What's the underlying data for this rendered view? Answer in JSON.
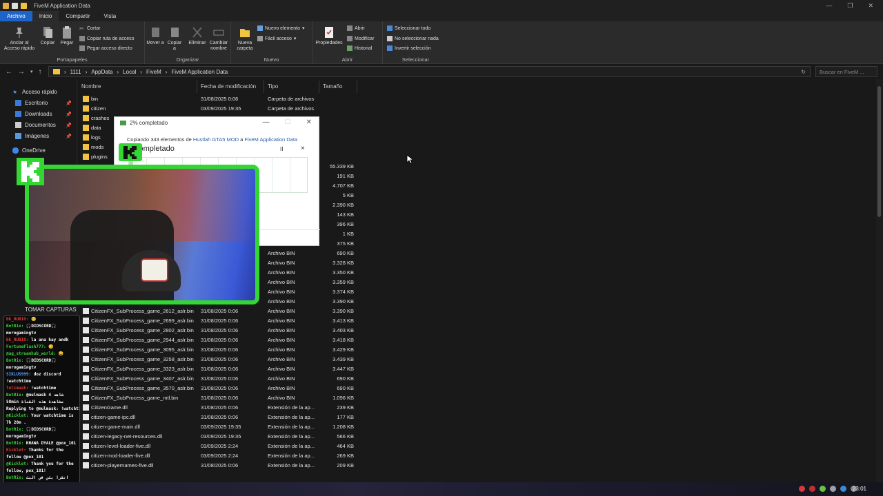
{
  "window": {
    "title": "FiveM Application Data"
  },
  "ribbon_tabs": [
    "Archivo",
    "Inicio",
    "Compartir",
    "Vista"
  ],
  "ribbon": {
    "pin_label": "Anclar al Acceso rápido",
    "copy": "Copiar",
    "paste": "Pegar",
    "cut": "Cortar",
    "copy_path": "Copiar ruta de acceso",
    "paste_shortcut": "Pegar acceso directo",
    "move_to": "Mover a",
    "copy_to": "Copiar a",
    "delete": "Eliminar",
    "rename": "Cambiar nombre",
    "new_folder": "Nueva carpeta",
    "new_item": "Nuevo elemento",
    "easy_access": "Fácil acceso",
    "properties": "Propiedades",
    "open": "Abrir",
    "edit": "Modificar",
    "history": "Historial",
    "select_all": "Seleccionar todo",
    "select_none": "No seleccionar nada",
    "invert": "Invertir selección",
    "groups": [
      "Portapapeles",
      "Organizar",
      "Nuevo",
      "Abrir",
      "Seleccionar"
    ]
  },
  "address": {
    "crumbs": [
      "1111",
      "AppData",
      "Local",
      "FiveM",
      "FiveM Application Data"
    ],
    "search_placeholder": "Buscar en FiveM ..."
  },
  "nav": {
    "quick": "Acceso rápido",
    "items": [
      "Escritorio",
      "Downloads",
      "Documentos",
      "Imágenes"
    ],
    "onedrive": "OneDrive",
    "capturas": "TOMAR CAPTURAS"
  },
  "columns": {
    "name": "Nombre",
    "date": "Fecha de modificación",
    "type": "Tipo",
    "size": "Tamaño"
  },
  "folders": [
    {
      "name": "bin",
      "date": "31/08/2025 0:06",
      "type": "Carpeta de archivos"
    },
    {
      "name": "citizen",
      "date": "03/09/2025 19:35",
      "type": "Carpeta de archivos"
    },
    {
      "name": "crashes"
    },
    {
      "name": "data"
    },
    {
      "name": "logs"
    },
    {
      "name": "mods"
    },
    {
      "name": "plugins"
    }
  ],
  "hidden_sizes": [
    "55.339 KB",
    "191 KB",
    "4.707 KB",
    "5 KB",
    "2.390 KB",
    "143 KB",
    "396 KB",
    "1 KB",
    "375 KB"
  ],
  "files": [
    {
      "name": "",
      "date": "",
      "type": "Archivo BIN",
      "size": "690 KB"
    },
    {
      "name": "",
      "date": "",
      "type": "Archivo BIN",
      "size": "3.328 KB"
    },
    {
      "name": "",
      "date": "",
      "type": "Archivo BIN",
      "size": "3.350 KB"
    },
    {
      "name": "",
      "date": "",
      "type": "Archivo BIN",
      "size": "3.359 KB"
    },
    {
      "name": "",
      "date": "",
      "type": "Archivo BIN",
      "size": "3.374 KB"
    },
    {
      "name": "",
      "date": "",
      "type": "Archivo BIN",
      "size": "3.390 KB"
    },
    {
      "name": "CitizenFX_SubProcess_game_2612_aslr.bin",
      "date": "31/08/2025 0:06",
      "type": "Archivo BIN",
      "size": "3.390 KB"
    },
    {
      "name": "CitizenFX_SubProcess_game_2699_aslr.bin",
      "date": "31/08/2025 0:06",
      "type": "Archivo BIN",
      "size": "3.413 KB"
    },
    {
      "name": "CitizenFX_SubProcess_game_2802_aslr.bin",
      "date": "31/08/2025 0:06",
      "type": "Archivo BIN",
      "size": "3.403 KB"
    },
    {
      "name": "CitizenFX_SubProcess_game_2944_aslr.bin",
      "date": "31/08/2025 0:06",
      "type": "Archivo BIN",
      "size": "3.418 KB"
    },
    {
      "name": "CitizenFX_SubProcess_game_3095_aslr.bin",
      "date": "31/08/2025 0:06",
      "type": "Archivo BIN",
      "size": "3.429 KB"
    },
    {
      "name": "CitizenFX_SubProcess_game_3258_aslr.bin",
      "date": "31/08/2025 0:06",
      "type": "Archivo BIN",
      "size": "3.439 KB"
    },
    {
      "name": "CitizenFX_SubProcess_game_3323_aslr.bin",
      "date": "31/08/2025 0:06",
      "type": "Archivo BIN",
      "size": "3.447 KB"
    },
    {
      "name": "CitizenFX_SubProcess_game_3407_aslr.bin",
      "date": "31/08/2025 0:06",
      "type": "Archivo BIN",
      "size": "690 KB"
    },
    {
      "name": "CitizenFX_SubProcess_game_3570_aslr.bin",
      "date": "31/08/2025 0:06",
      "type": "Archivo BIN",
      "size": "690 KB"
    },
    {
      "name": "CitizenFX_SubProcess_game_mtl.bin",
      "date": "31/08/2025 0:06",
      "type": "Archivo BIN",
      "size": "1.096 KB"
    },
    {
      "name": "CitizenGame.dll",
      "date": "31/08/2025 0:06",
      "type": "Extensión de la ap...",
      "size": "239 KB"
    },
    {
      "name": "citizen-game-ipc.dll",
      "date": "31/08/2025 0:06",
      "type": "Extensión de la ap...",
      "size": "177 KB"
    },
    {
      "name": "citizen-game-main.dll",
      "date": "03/09/2025 19:35",
      "type": "Extensión de la ap...",
      "size": "1.208 KB"
    },
    {
      "name": "citizen-legacy-net-resources.dll",
      "date": "03/09/2025 19:35",
      "type": "Extensión de la ap...",
      "size": "566 KB"
    },
    {
      "name": "citizen-level-loader-five.dll",
      "date": "03/09/2025 2:24",
      "type": "Extensión de la ap...",
      "size": "464 KB"
    },
    {
      "name": "citizen-mod-loader-five.dll",
      "date": "03/09/2025 2:24",
      "type": "Extensión de la ap...",
      "size": "269 KB"
    },
    {
      "name": "citizen-playernames-five.dll",
      "date": "31/08/2025 0:06",
      "type": "Extensión de la ap...",
      "size": "209 KB"
    }
  ],
  "dialog": {
    "title": "2% completado",
    "line_prefix": "Copiando 343 elementos de ",
    "src": "Hustlah GTA5 MOD",
    "mid": " a ",
    "dst": "FiveM Application Data",
    "pct": "completado",
    "pause": "II",
    "cancel": "×"
  },
  "chat": [
    {
      "user": "bk_RUBIO:",
      "text": "😊",
      "color": "r"
    },
    {
      "user": "BotRix:",
      "text": "🎧DIDSCORD🎧",
      "color": "u"
    },
    {
      "user": "",
      "text": "morogamingtv",
      "color": "u"
    },
    {
      "user": "bk_RUBIO:",
      "text": "la ana hay andk",
      "color": "r"
    },
    {
      "user": "FortuneFlash777:",
      "text": "🙂",
      "color": "u"
    },
    {
      "user": "@ag_streamhub_world:",
      "text": "😄",
      "color": "u"
    },
    {
      "user": "BotRix:",
      "text": "🎧DIDSCORD🎧",
      "color": "u"
    },
    {
      "user": "",
      "text": "morogamingtv",
      "color": "u"
    },
    {
      "user": "SIKLUS999:",
      "text": "doz discord",
      "color": "b"
    },
    {
      "user": "",
      "text": "!watchtime",
      "color": "u"
    },
    {
      "user": "lolimask:",
      "text": "!watchtime",
      "color": "r"
    },
    {
      "user": "BotRix:",
      "text": "@mulmask 4 شاهد",
      "color": "u"
    },
    {
      "user": "",
      "text": "58min مشاهدة هذه القناة",
      "color": "u"
    },
    {
      "user": "",
      "text": "Replying to @mulmask: !watchtime",
      "color": "u"
    },
    {
      "user": "@Kicklet:",
      "text": "Your watchtime is",
      "color": "u"
    },
    {
      "user": "",
      "text": "7h 20m .",
      "color": "u"
    },
    {
      "user": "BotRix:",
      "text": "🎧DIDSCORD🎧",
      "color": "u"
    },
    {
      "user": "",
      "text": "morogamingtv",
      "color": "u"
    },
    {
      "user": "BotRix:",
      "text": "KHAWA DYALE @pox_101",
      "color": "u"
    },
    {
      "user": "Kicklet:",
      "text": "Thanks for the",
      "color": "r"
    },
    {
      "user": "",
      "text": "follow @pox_101",
      "color": "u"
    },
    {
      "user": "@Kicklet:",
      "text": "Thank you for the",
      "color": "u"
    },
    {
      "user": "",
      "text": "follow, pox_101!",
      "color": "u"
    },
    {
      "user": "BotRix:",
      "text": "انقرا بثي في البث",
      "color": "u"
    },
    {
      "user": "",
      "text": "المباشر على Kick!",
      "color": "u"
    }
  ],
  "tray": {
    "time": "23:01"
  },
  "colors": {
    "accent": "#1e64c8",
    "kick_green": "#33d633",
    "folder": "#f0c341"
  }
}
